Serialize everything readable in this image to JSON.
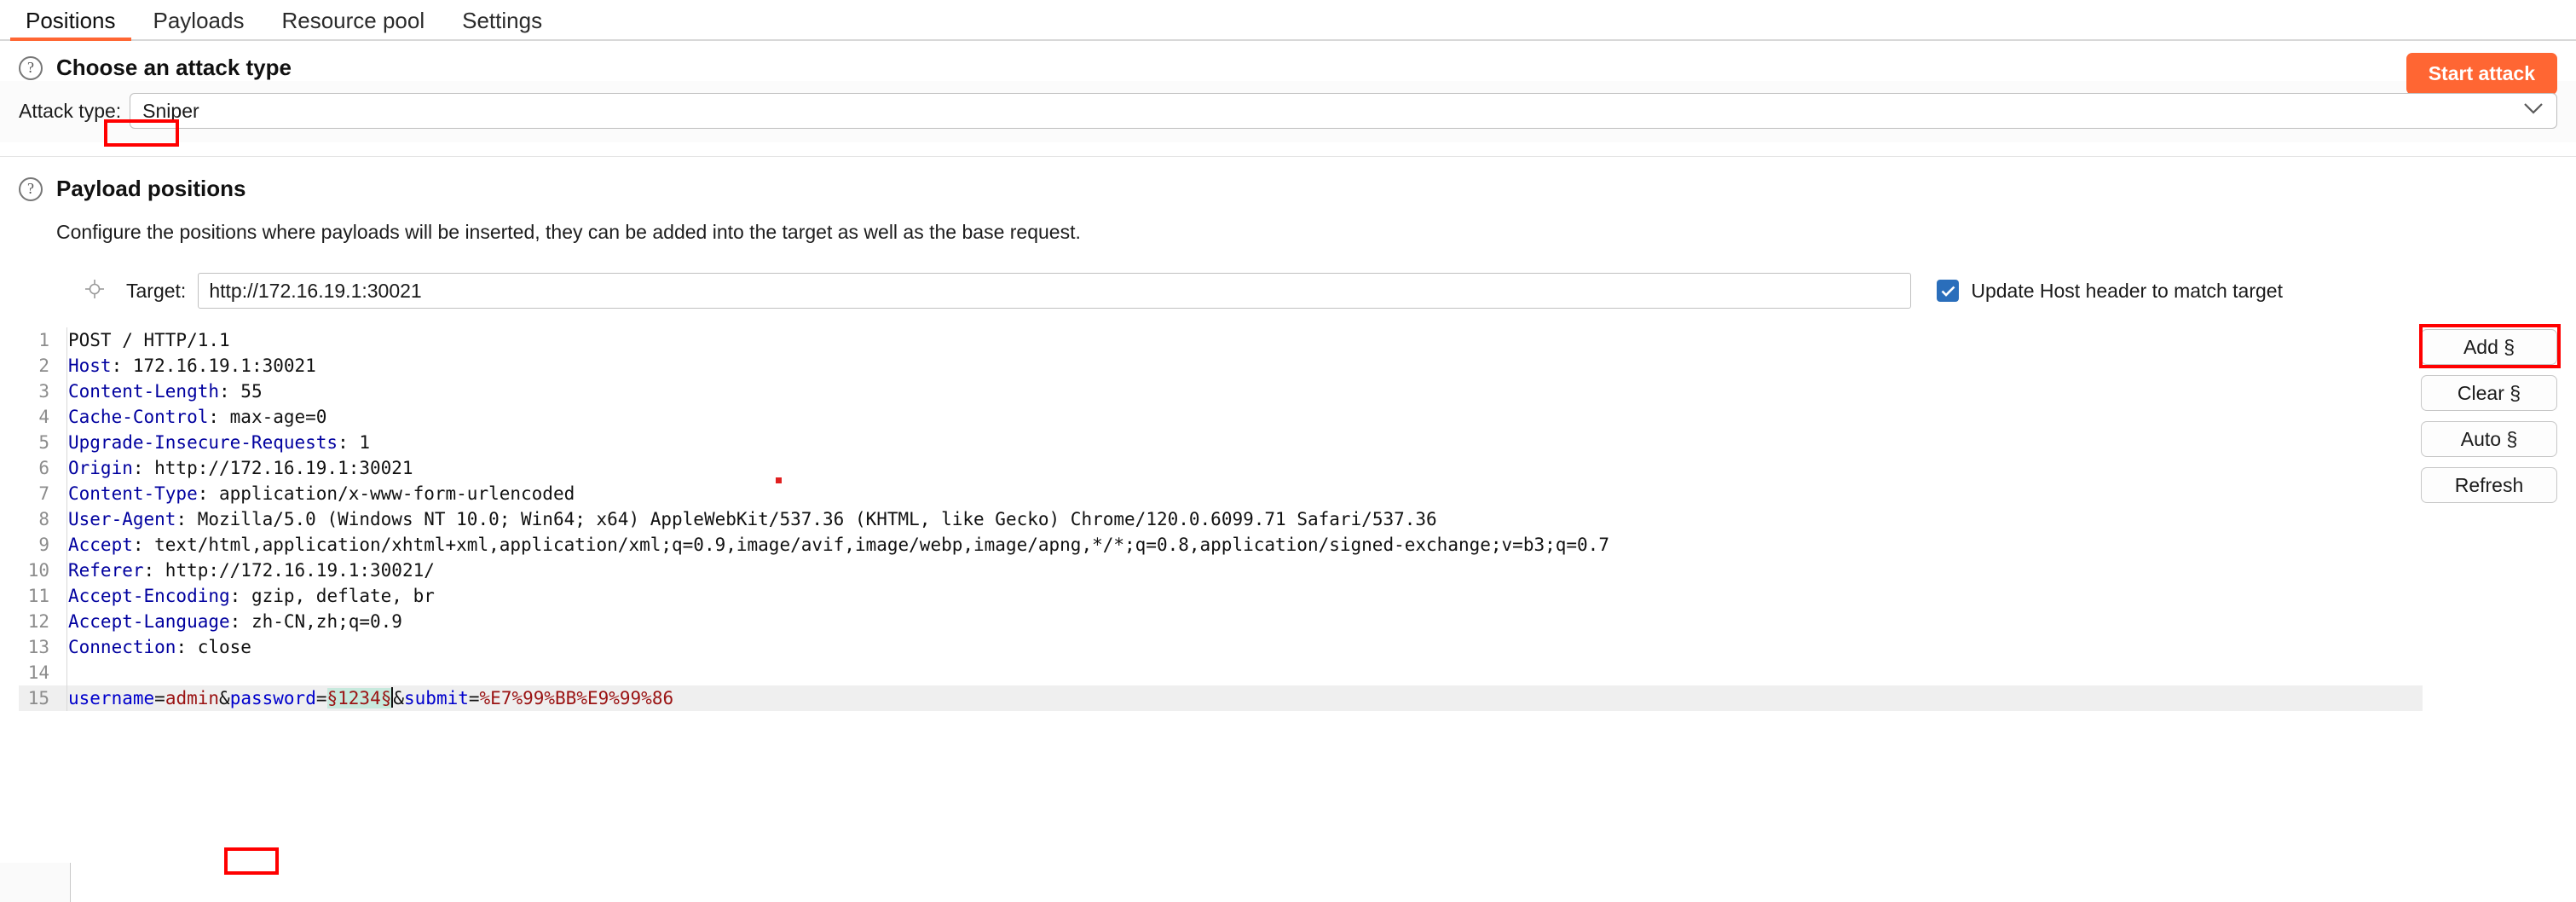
{
  "tabs": [
    {
      "label": "Positions",
      "active": true
    },
    {
      "label": "Payloads",
      "active": false
    },
    {
      "label": "Resource pool",
      "active": false
    },
    {
      "label": "Settings",
      "active": false
    }
  ],
  "attack_type_section": {
    "help_icon": "question-mark-icon",
    "title": "Choose an attack type",
    "label": "Attack type:",
    "value": "Sniper",
    "chevron": "chevron-down-icon",
    "start_button": "Start attack",
    "start_button_color": "#ff6633"
  },
  "payload_positions": {
    "help_icon": "question-mark-icon",
    "title": "Payload positions",
    "description": "Configure the positions where payloads will be inserted, they can be added into the target as well as the base request.",
    "target_icon": "crosshair-icon",
    "target_label": "Target:",
    "target_value": "http://172.16.19.1:30021",
    "checkbox_checked": true,
    "checkbox_label": "Update Host header to match target",
    "checkbox_color": "#2a6ebb",
    "buttons": [
      {
        "label": "Add §",
        "highlighted": true
      },
      {
        "label": "Clear §",
        "highlighted": false
      },
      {
        "label": "Auto §",
        "highlighted": false
      },
      {
        "label": "Refresh",
        "highlighted": false
      }
    ]
  },
  "request": {
    "lines": [
      {
        "n": "1",
        "parts": [
          {
            "t": "POST / HTTP/1.1",
            "c": "val"
          }
        ]
      },
      {
        "n": "2",
        "parts": [
          {
            "t": "Host",
            "c": "hdr"
          },
          {
            "t": ": 172.16.19.1:30021",
            "c": "val"
          }
        ]
      },
      {
        "n": "3",
        "parts": [
          {
            "t": "Content-Length",
            "c": "hdr"
          },
          {
            "t": ": 55",
            "c": "val"
          }
        ]
      },
      {
        "n": "4",
        "parts": [
          {
            "t": "Cache-Control",
            "c": "hdr"
          },
          {
            "t": ": max-age=0",
            "c": "val"
          }
        ]
      },
      {
        "n": "5",
        "parts": [
          {
            "t": "Upgrade-Insecure-Requests",
            "c": "hdr"
          },
          {
            "t": ": 1",
            "c": "val"
          }
        ]
      },
      {
        "n": "6",
        "parts": [
          {
            "t": "Origin",
            "c": "hdr"
          },
          {
            "t": ": http://172.16.19.1:30021",
            "c": "val"
          }
        ]
      },
      {
        "n": "7",
        "parts": [
          {
            "t": "Content-Type",
            "c": "hdr"
          },
          {
            "t": ": application/x-www-form-urlencoded",
            "c": "val"
          }
        ]
      },
      {
        "n": "8",
        "parts": [
          {
            "t": "User-Agent",
            "c": "hdr"
          },
          {
            "t": ": Mozilla/5.0 (Windows NT 10.0; Win64; x64) AppleWebKit/537.36 (KHTML, like Gecko) Chrome/120.0.6099.71 Safari/537.36",
            "c": "val"
          }
        ]
      },
      {
        "n": "9",
        "parts": [
          {
            "t": "Accept",
            "c": "hdr"
          },
          {
            "t": ": text/html,application/xhtml+xml,application/xml;q=0.9,image/avif,image/webp,image/apng,*/*;q=0.8,application/signed-exchange;v=b3;q=0.7",
            "c": "val"
          }
        ]
      },
      {
        "n": "10",
        "parts": [
          {
            "t": "Referer",
            "c": "hdr"
          },
          {
            "t": ": http://172.16.19.1:30021/",
            "c": "val"
          }
        ]
      },
      {
        "n": "11",
        "parts": [
          {
            "t": "Accept-Encoding",
            "c": "hdr"
          },
          {
            "t": ": gzip, deflate, br",
            "c": "val"
          }
        ]
      },
      {
        "n": "12",
        "parts": [
          {
            "t": "Accept-Language",
            "c": "hdr"
          },
          {
            "t": ": zh-CN,zh;q=0.9",
            "c": "val"
          }
        ]
      },
      {
        "n": "13",
        "parts": [
          {
            "t": "Connection",
            "c": "hdr"
          },
          {
            "t": ": close",
            "c": "val"
          }
        ]
      },
      {
        "n": "14",
        "parts": [
          {
            "t": "",
            "c": "val"
          }
        ]
      },
      {
        "n": "15",
        "highlight": true,
        "parts": [
          {
            "t": "username",
            "c": "blue"
          },
          {
            "t": "=",
            "c": "val"
          },
          {
            "t": "admin",
            "c": "red"
          },
          {
            "t": "&",
            "c": "val"
          },
          {
            "t": "password",
            "c": "blue"
          },
          {
            "t": "=",
            "c": "val"
          },
          {
            "t": "§1234§",
            "c": "marker"
          },
          {
            "t": "caret",
            "c": "caret"
          },
          {
            "t": "&",
            "c": "val"
          },
          {
            "t": "submit",
            "c": "blue"
          },
          {
            "t": "=",
            "c": "val"
          },
          {
            "t": "%E7%99%BB%E9%99%86",
            "c": "red"
          }
        ]
      }
    ]
  }
}
